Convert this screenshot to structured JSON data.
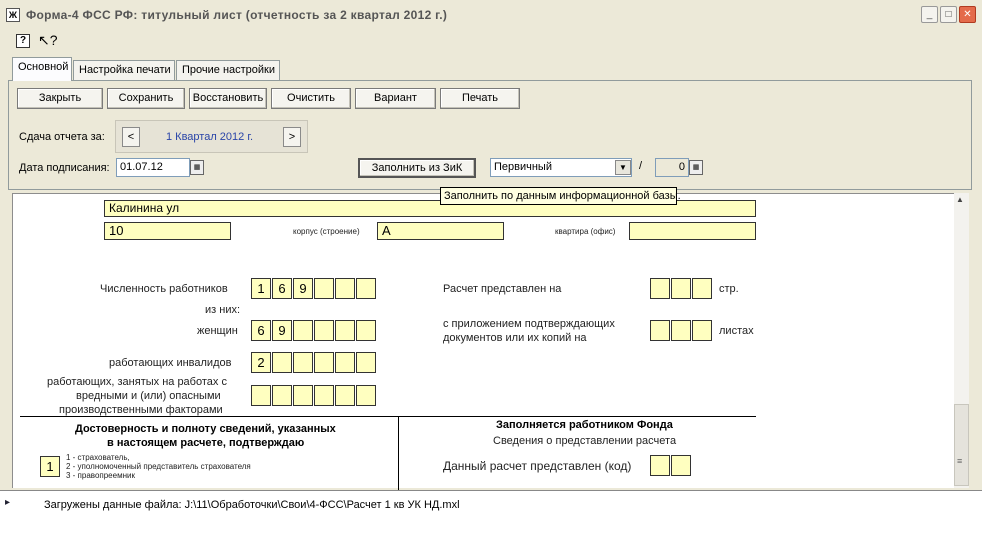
{
  "window": {
    "title": "Форма-4 ФСС РФ: титульный лист (отчетность за 2 квартал 2012 г.)",
    "controls": [
      "_",
      "□",
      "✕"
    ]
  },
  "toolbar": {
    "help_icon_text": "?",
    "cursor_icon_text": "↖?"
  },
  "tabs": [
    {
      "label": "Основной",
      "active": true
    },
    {
      "label": "Настройка печати",
      "active": false
    },
    {
      "label": "Прочие настройки",
      "active": false
    }
  ],
  "buttons": {
    "close": "Закрыть",
    "save": "Сохранить",
    "restore": "Восстановить",
    "clear": "Очистить",
    "variant": "Вариант",
    "print": "Печать",
    "fill_from_zik": "Заполнить из ЗиК"
  },
  "period": {
    "label": "Сдача отчета за:",
    "value": "1 Квартал 2012 г.",
    "prev": "<",
    "next": ">"
  },
  "signing_date": {
    "label": "Дата подписания:",
    "value": "01.07.12"
  },
  "report_type": {
    "value": "Первичный"
  },
  "correction": {
    "separator": "/",
    "value": "0"
  },
  "tooltip": "Заполнить по данным информационной базы.",
  "form": {
    "street": "Калинина ул",
    "house": "10",
    "building_label": "корпус (строение)",
    "building": "А",
    "apartment_label": "квартира (офис)",
    "apartment": "",
    "employees_label": "Численность работников",
    "employees_digits": [
      "1",
      "6",
      "9",
      "",
      "",
      ""
    ],
    "of_them_label": "из них:",
    "women_label": "женщин",
    "women_digits": [
      "6",
      "9",
      "",
      "",
      "",
      ""
    ],
    "disabled_label": "работающих инвалидов",
    "disabled_digits": [
      "2",
      "",
      "",
      "",
      "",
      ""
    ],
    "hazardous_label_1": "работающих, занятых на работах с",
    "hazardous_label_2": "вредными и (или) опасными",
    "hazardous_label_3": "производственными факторами",
    "hazardous_digits": [
      "",
      "",
      "",
      "",
      "",
      ""
    ],
    "pages_label": "Расчет представлен на",
    "pages_digits": [
      "",
      "",
      ""
    ],
    "pages_unit": "стр.",
    "attach_label_1": "с приложением подтверждающих",
    "attach_label_2": "документов или их копий на",
    "attach_digits": [
      "",
      "",
      ""
    ],
    "attach_unit": "листах",
    "reliability_title_1": "Достоверность и полноту сведений, указанных",
    "reliability_title_2": "в настоящем расчете, подтверждаю",
    "signer_code": "1",
    "signer_opt_1": "1 - страхователь,",
    "signer_opt_2": "2 - уполномоченный представитель страхователя",
    "signer_opt_3": "3 - правопреемник",
    "fund_title": "Заполняется работником Фонда",
    "fund_subtitle": "Сведения о представлении расчета",
    "submitted_code_label": "Данный расчет представлен (код)",
    "submitted_code_digits": [
      "",
      ""
    ]
  },
  "status": {
    "marker": "▸",
    "message": "Загружены данные файла: J:\\11\\Обработочки\\Свои\\4-ФСС\\Расчет 1 кв УК НД.mxl"
  }
}
